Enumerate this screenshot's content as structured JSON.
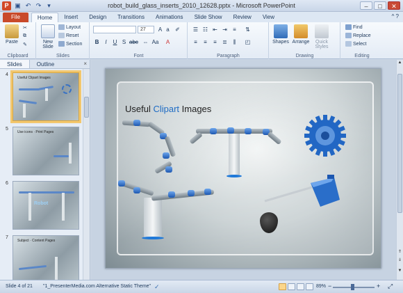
{
  "window": {
    "title": "robot_build_glass_inserts_2010_12628.pptx - Microsoft PowerPoint",
    "app_icon": "P",
    "controls": [
      "–",
      "□",
      "✕"
    ]
  },
  "tabs": [
    "File",
    "Home",
    "Insert",
    "Design",
    "Transitions",
    "Animations",
    "Slide Show",
    "Review",
    "View"
  ],
  "ribbon": {
    "clipboard": {
      "paste": "Paste",
      "label": "Clipboard"
    },
    "slides": {
      "new_slide": "New Slide",
      "layout": "Layout",
      "reset": "Reset",
      "section": "Section",
      "label": "Slides"
    },
    "font": {
      "size": "27",
      "label": "Font"
    },
    "paragraph": {
      "label": "Paragraph"
    },
    "drawing": {
      "shapes": "Shapes",
      "arrange": "Arrange",
      "quick_styles": "Quick Styles",
      "label": "Drawing"
    },
    "editing": {
      "find": "Find",
      "replace": "Replace",
      "select": "Select",
      "label": "Editing"
    }
  },
  "pane": {
    "tabs": [
      "Slides",
      "Outline"
    ],
    "close": "×",
    "slides": [
      {
        "num": "4",
        "title": "Useful Clipart Images",
        "selected": true
      },
      {
        "num": "5",
        "title": "Use icons · Print Pages",
        "selected": false
      },
      {
        "num": "6",
        "title": "Robot",
        "selected": false
      },
      {
        "num": "7",
        "title": "Subject · Content Pages",
        "selected": false
      }
    ]
  },
  "slide": {
    "title_pre": "Useful ",
    "title_hl": "Clipart",
    "title_post": " Images"
  },
  "status": {
    "slide_info": "Slide 4 of 21",
    "theme": "\"1_PresenterMedia.com Alternative Static Theme\"",
    "zoom": "89%"
  },
  "colors": {
    "accent": "#1f6cc4",
    "file_tab": "#c94a2a",
    "selection": "#f2c76e"
  }
}
